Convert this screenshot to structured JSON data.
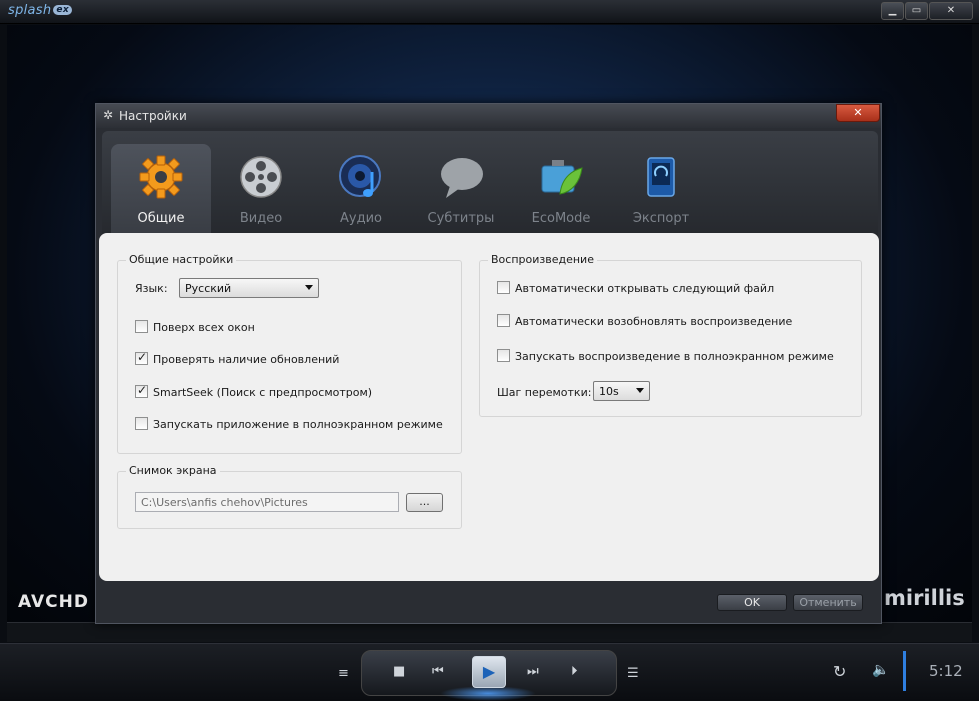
{
  "app": {
    "logo_text": "splash",
    "logo_badge": "ex",
    "watermark_left": "AVCHD",
    "watermark_right": "mirillis",
    "timecode": "5:12"
  },
  "dialog": {
    "title": "Настройки",
    "tabs": [
      {
        "label": "Общие",
        "icon": "gear-icon",
        "active": true
      },
      {
        "label": "Видео",
        "icon": "film-reel-icon",
        "active": false
      },
      {
        "label": "Аудио",
        "icon": "speaker-note-icon",
        "active": false
      },
      {
        "label": "Субтитры",
        "icon": "speech-bubble-icon",
        "active": false
      },
      {
        "label": "EcoMode",
        "icon": "battery-leaf-icon",
        "active": false
      },
      {
        "label": "Экспорт",
        "icon": "export-device-icon",
        "active": false
      }
    ],
    "general": {
      "legend": "Общие настройки",
      "language_label": "Язык:",
      "language_value": "Русский",
      "options": [
        {
          "label": "Поверх всех окон",
          "checked": false
        },
        {
          "label": "Проверять наличие обновлений",
          "checked": true
        },
        {
          "label": "SmartSeek (Поиск с предпросмотром)",
          "checked": true
        },
        {
          "label": "Запускать приложение в полноэкранном режиме",
          "checked": false
        }
      ]
    },
    "screenshot": {
      "legend": "Снимок экрана",
      "path": "C:\\Users\\anfis chehov\\Pictures",
      "browse_label": "..."
    },
    "playback": {
      "legend": "Воспроизведение",
      "options": [
        {
          "label": "Автоматически открывать следующий файл",
          "checked": false
        },
        {
          "label": "Автоматически возобновлять воспроизведение",
          "checked": false
        },
        {
          "label": "Запускать воспроизведение в полноэкранном режиме",
          "checked": false
        }
      ],
      "seek_label": "Шаг перемотки:",
      "seek_value": "10s"
    },
    "ok_label": "OK",
    "cancel_label": "Отменить"
  }
}
